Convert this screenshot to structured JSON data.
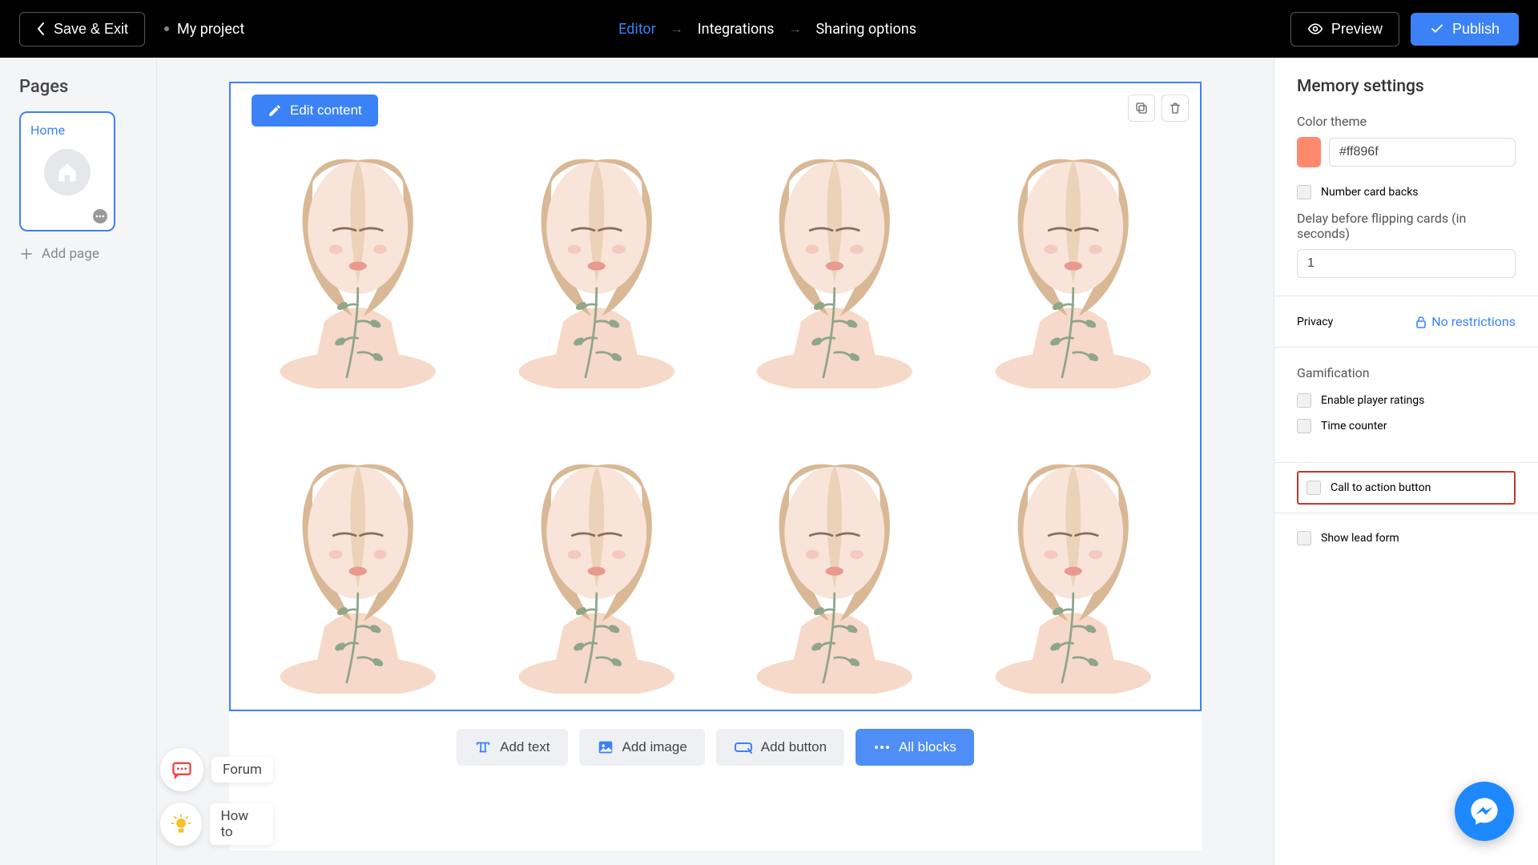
{
  "header": {
    "save_exit": "Save & Exit",
    "project_name": "My project",
    "tabs": {
      "editor": "Editor",
      "integrations": "Integrations",
      "sharing": "Sharing options"
    },
    "preview": "Preview",
    "publish": "Publish"
  },
  "sidebar": {
    "title": "Pages",
    "home_label": "Home",
    "add_page": "Add page"
  },
  "float": {
    "forum": "Forum",
    "howto": "How to"
  },
  "canvas": {
    "edit_content": "Edit content",
    "add_text": "Add text",
    "add_image": "Add image",
    "add_button": "Add button",
    "all_blocks": "All blocks"
  },
  "panel": {
    "title": "Memory settings",
    "color_theme_label": "Color theme",
    "color_value": "#ff896f",
    "color_swatch": "#ff896f",
    "number_card_backs": "Number card backs",
    "delay_label": "Delay before flipping cards (in seconds)",
    "delay_value": "1",
    "privacy_label": "Privacy",
    "privacy_value": "No restrictions",
    "gamification": "Gamification",
    "enable_ratings": "Enable player ratings",
    "time_counter": "Time counter",
    "cta": "Call to action button",
    "show_lead": "Show lead form"
  }
}
